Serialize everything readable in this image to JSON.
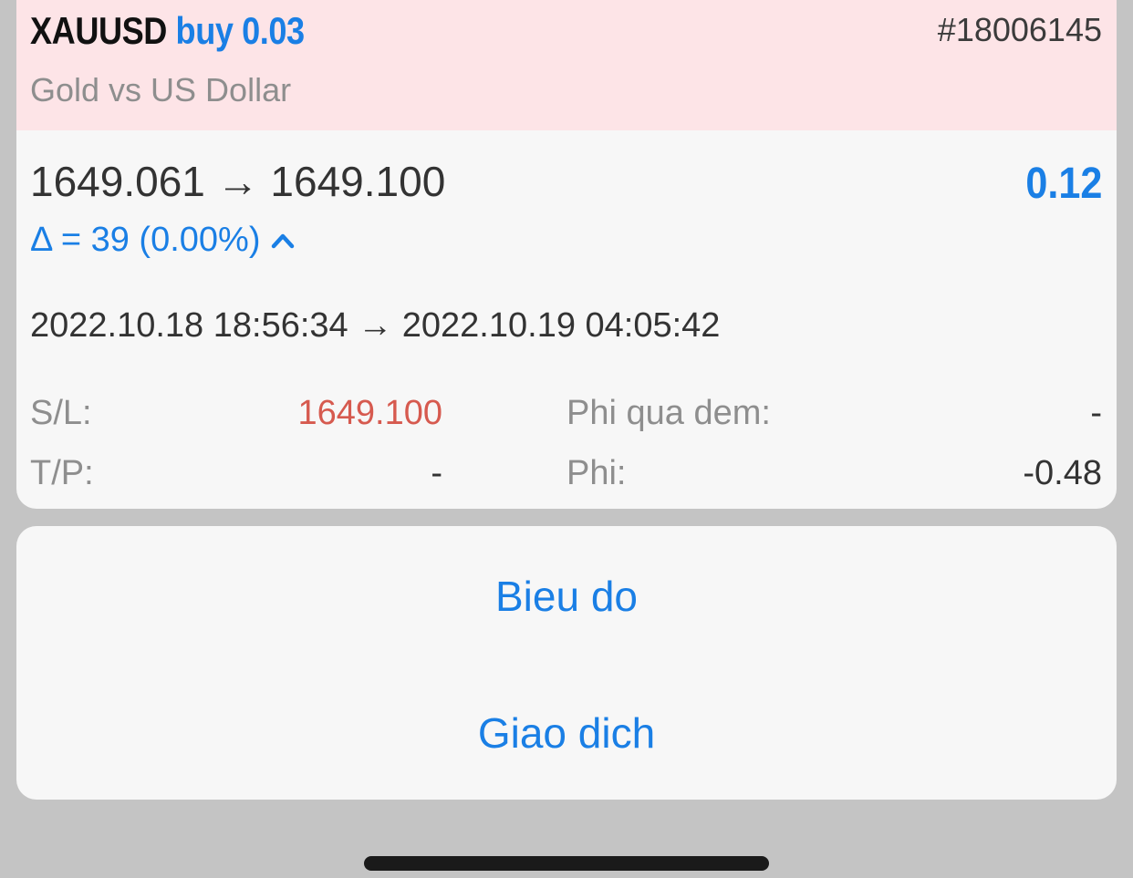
{
  "order": {
    "symbol": "XAUUSD",
    "side_volume": "buy 0.03",
    "ticket": "#18006145",
    "description": "Gold vs US Dollar",
    "prices": "1649.061 → 1649.100",
    "profit": "0.12",
    "delta": "Δ = 39 (0.00%)",
    "times": "2022.10.18 18:56:34 → 2022.10.19 04:05:42"
  },
  "details": {
    "sl_label": "S/L:",
    "sl_value": "1649.100",
    "tp_label": "T/P:",
    "tp_value": "-",
    "swap_label": "Phi qua dem:",
    "swap_value": "-",
    "fee_label": "Phi:",
    "fee_value": "-0.48"
  },
  "actions": {
    "chart": "Bieu do",
    "trade": "Giao dich"
  },
  "colors": {
    "accent_blue": "#1a7fe5",
    "loss_red": "#d65a4f",
    "header_pink": "#fde4e7",
    "card_bg": "#f7f7f7",
    "backdrop_gray": "#c4c4c4"
  },
  "icons": {
    "delta_expand": "chevron-up-icon"
  }
}
